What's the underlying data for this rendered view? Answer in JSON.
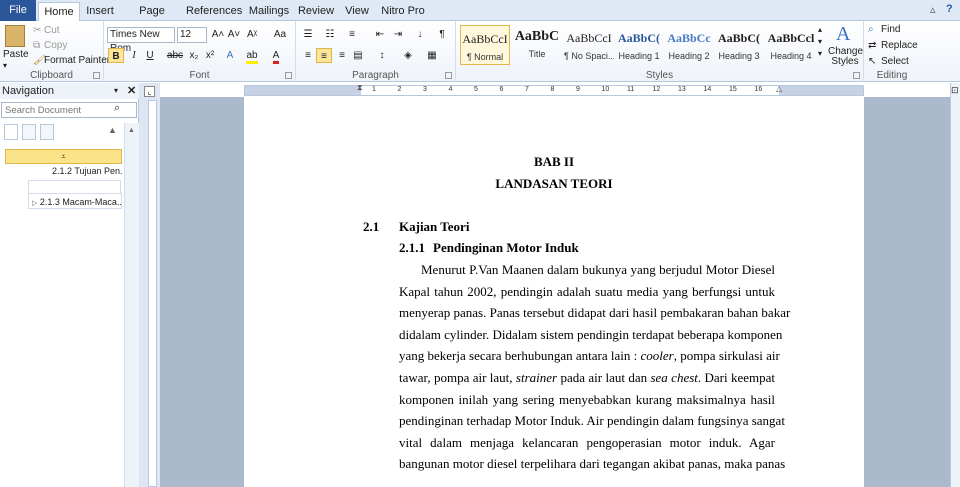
{
  "tabs": [
    "File",
    "Home",
    "Insert",
    "Page Layout",
    "References",
    "Mailings",
    "Review",
    "View",
    "Nitro Pro"
  ],
  "clipboard": {
    "paste": "Paste",
    "cut": "Cut",
    "copy": "Copy",
    "format_painter": "Format Painter",
    "label": "Clipboard"
  },
  "font": {
    "name": "Times New Rom",
    "size": "12",
    "label": "Font",
    "bold": "B",
    "italic": "I",
    "underline": "U",
    "strike": "abc",
    "sub": "x₂",
    "sup": "x²"
  },
  "paragraph": {
    "label": "Paragraph"
  },
  "styles": {
    "label": "Styles",
    "items": [
      {
        "sample": "AaBbCcI",
        "name": "¶ Normal"
      },
      {
        "sample": "AaBbC",
        "name": "Title"
      },
      {
        "sample": "AaBbCcI",
        "name": "¶ No Spaci..."
      },
      {
        "sample": "AaBbC(",
        "name": "Heading 1"
      },
      {
        "sample": "AaBbCc",
        "name": "Heading 2"
      },
      {
        "sample": "AaBbC(",
        "name": "Heading 3"
      },
      {
        "sample": "AaBbCcl",
        "name": "Heading 4"
      }
    ],
    "change": "Change Styles"
  },
  "editing": {
    "label": "Editing",
    "find": "Find",
    "replace": "Replace",
    "select": "Select"
  },
  "nav": {
    "title": "Navigation",
    "search_placeholder": "Search Document",
    "items": [
      "2.1.2 Tujuan Pen...",
      "2.1.3 Macam-Maca..."
    ]
  },
  "ruler": [
    "1",
    "2",
    "3",
    "4",
    "5",
    "6",
    "7",
    "8",
    "9",
    "10",
    "11",
    "12",
    "13",
    "14",
    "15",
    "16"
  ],
  "doc": {
    "chapter": "BAB II",
    "chapter_title": "LANDASAN TEORI",
    "sec_num": "2.1",
    "sec_title": "Kajian Teori",
    "sub_num": "2.1.1",
    "sub_title": "Pendinginan Motor Induk",
    "lines": [
      "Menurut P.Van Maanen dalam bukunya yang berjudul Motor Diesel",
      "Kapal tahun 2002, pendingin adalah suatu media yang berfungsi untuk",
      "menyerap panas. Panas tersebut didapat dari hasil pembakaran bahan bakar",
      "didalam cylinder. Didalam sistem pendingin terdapat beberapa komponen",
      "yang bekerja secara berhubungan antara lain : ",
      "cooler",
      ", pompa sirkulasi air",
      "tawar, pompa air laut, ",
      "strainer",
      " pada air laut dan ",
      "sea chest",
      ". Dari keempat",
      "komponen inilah yang sering menyebabkan kurang maksimalnya hasil",
      "pendinginan terhadap Motor Induk. Air pendingin dalam fungsinya sangat",
      "vital dalam menjaga kelancaran pengoperasian motor induk.  Agar",
      "bangunan motor diesel terpelihara dari tegangan akibat panas, maka panas"
    ]
  }
}
